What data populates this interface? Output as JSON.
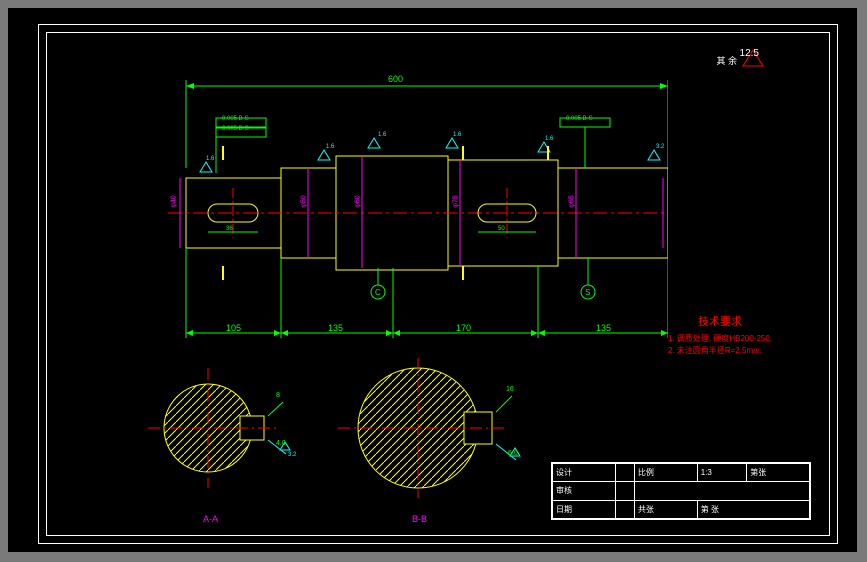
{
  "surface_note": {
    "label": "其 余",
    "value": "12.5"
  },
  "dimensions": {
    "overall": "600",
    "seg1": "105",
    "seg2": "135",
    "seg3": "170",
    "seg4": "135"
  },
  "tolerance_boxes": {
    "t1": "0.005 B-S",
    "t2": "0.005 B-S",
    "t3": "0.005 B-S"
  },
  "datums": {
    "c": "C",
    "s": "S"
  },
  "section_labels": {
    "aa": "A-A",
    "bb": "B-B"
  },
  "diameters": {
    "d1": "φ40",
    "d2": "φ50",
    "d3": "φ60",
    "d4": "φ75",
    "d5": "φ65"
  },
  "keyway": {
    "left_len": "36",
    "right_len": "50"
  },
  "roughness": {
    "r1": "1.6",
    "r2": "1.6",
    "r3": "1.6",
    "r4": "1.6",
    "r5": "1.6",
    "r6": "3.2",
    "r7": "3.2"
  },
  "section_dims": {
    "a_key_w": "8",
    "a_key_h": "4.0",
    "b_key_w": "16",
    "b_key_h": "6.0"
  },
  "tech_req": {
    "title": "技术要求",
    "line1": "1. 调质处理, 硬度HB200-250.",
    "line2": "2. 未注圆角半径R=2.5mm."
  },
  "titleblock": {
    "r1c1": "设计",
    "r1c2": "",
    "r1c3": "比例",
    "r1c4": "1:3",
    "r1c5": "第张",
    "r2c1": "审核",
    "r2c2": "",
    "r2c3": "",
    "r2c4": "",
    "r2c5": "",
    "r3c1": "日期",
    "r3c2": "",
    "r3c3": "共张",
    "r3c4": "第 张",
    "r3c5": ""
  }
}
